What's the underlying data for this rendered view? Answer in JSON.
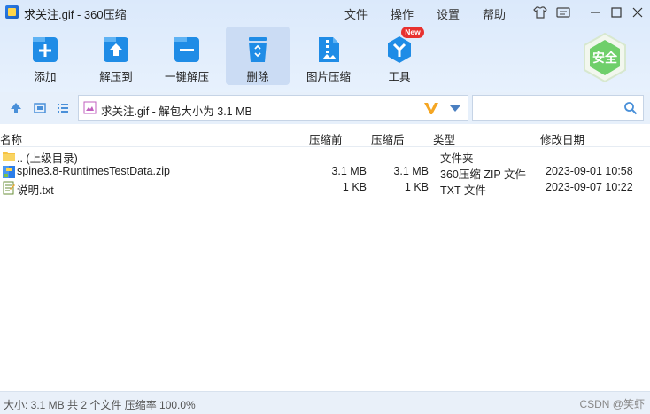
{
  "window": {
    "title": "求关注.gif - 360压缩",
    "menu": [
      {
        "label": "文件"
      },
      {
        "label": "操作"
      },
      {
        "label": "设置"
      },
      {
        "label": "帮助"
      }
    ]
  },
  "toolbar": {
    "items": [
      {
        "label": "添加",
        "icon": "add-icon"
      },
      {
        "label": "解压到",
        "icon": "extract-to-icon"
      },
      {
        "label": "一键解压",
        "icon": "one-click-extract-icon"
      },
      {
        "label": "删除",
        "icon": "recycle-delete-icon",
        "active": true
      },
      {
        "label": "图片压缩",
        "icon": "image-compress-icon"
      },
      {
        "label": "工具",
        "icon": "tools-icon"
      }
    ],
    "new_badge": "New",
    "safe_label": "安全"
  },
  "address": {
    "path": "求关注.gif - 解包大小为 3.1 MB"
  },
  "search": {
    "value": ""
  },
  "columns": {
    "name": "名称",
    "packed": "压缩前",
    "unpacked": "压缩后",
    "type": "类型",
    "modified": "修改日期"
  },
  "rows": [
    {
      "name": ".. (上级目录)",
      "packed": "",
      "unpacked": "",
      "type": "文件夹",
      "modified": "",
      "icon": "folder-icon"
    },
    {
      "name": "spine3.8-RuntimesTestData.zip",
      "packed": "3.1 MB",
      "unpacked": "3.1 MB",
      "type": "360压缩 ZIP 文件",
      "modified": "2023-09-01 10:58",
      "icon": "zip-file-icon"
    },
    {
      "name": "说明.txt",
      "packed": "1 KB",
      "unpacked": "1 KB",
      "type": "TXT 文件",
      "modified": "2023-09-07 10:22",
      "icon": "text-file-icon"
    }
  ],
  "status": {
    "summary": "大小: 3.1 MB 共 2 个文件 压缩率 100.0%",
    "watermark": "CSDN @笑虾"
  },
  "colors": {
    "accent": "#1f8ce6",
    "toolbar_bg": "#dbe9fb",
    "safe_green": "#6fcf6a"
  }
}
